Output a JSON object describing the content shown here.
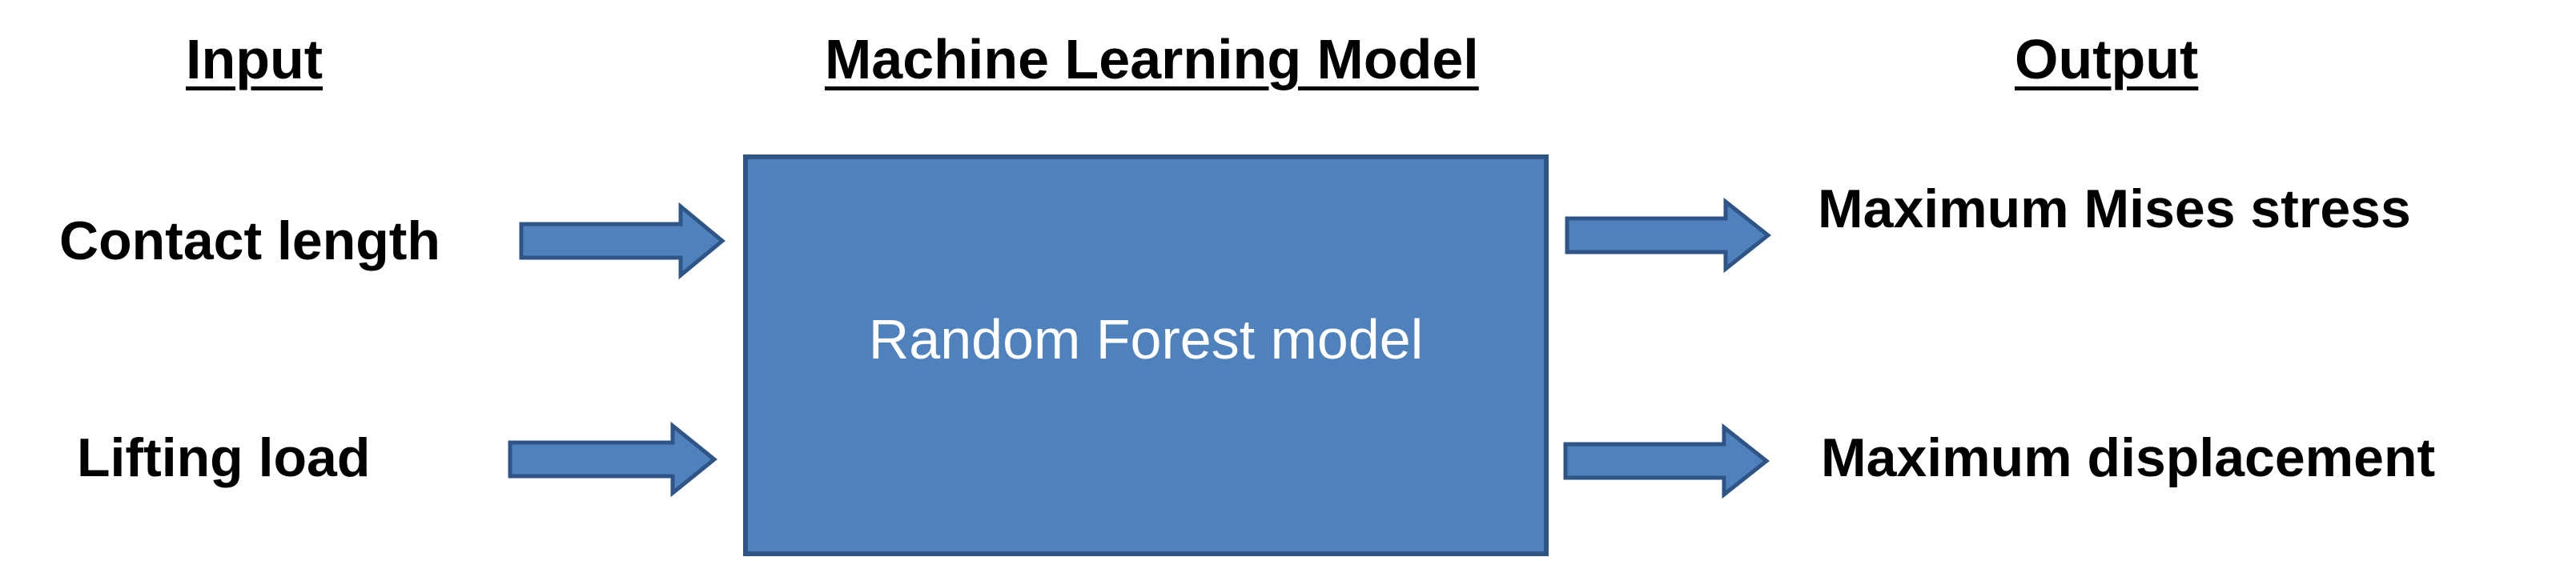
{
  "headings": {
    "input": "Input",
    "model": "Machine Learning Model",
    "output": "Output"
  },
  "inputs": [
    "Contact length",
    "Lifting load"
  ],
  "model": {
    "label": "Random Forest model"
  },
  "outputs": [
    "Maximum Mises stress",
    "Maximum displacement"
  ],
  "colors": {
    "box_fill": "#4f81bd",
    "box_border": "#2e5585",
    "arrow_fill": "#4f81bd",
    "arrow_border": "#2e5585",
    "text": "#000000",
    "model_text": "#ffffff"
  }
}
